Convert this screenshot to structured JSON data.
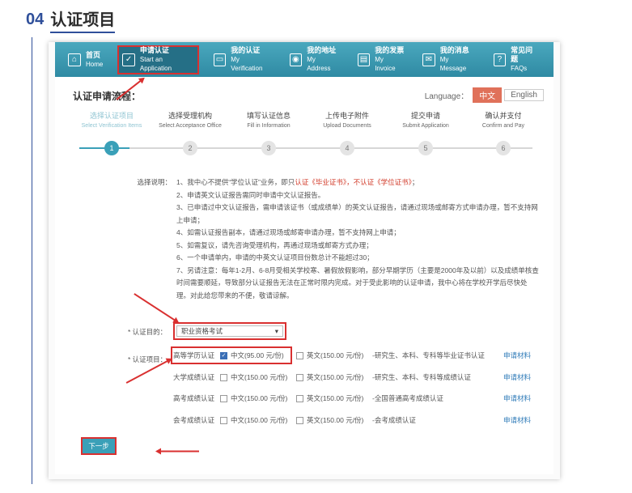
{
  "section": {
    "number": "04",
    "title": "认证项目"
  },
  "nav": [
    {
      "cn": "首页",
      "en": "Home",
      "icon": "home-icon",
      "glyph": "⌂"
    },
    {
      "cn": "申请认证",
      "en": "Start an Application",
      "icon": "check-icon",
      "glyph": "✓"
    },
    {
      "cn": "我的认证",
      "en": "My Verification",
      "icon": "card-icon",
      "glyph": "▭"
    },
    {
      "cn": "我的地址",
      "en": "My Address",
      "icon": "location-icon",
      "glyph": "◉"
    },
    {
      "cn": "我的发票",
      "en": "My Invoice",
      "icon": "invoice-icon",
      "glyph": "▤"
    },
    {
      "cn": "我的消息",
      "en": "My Message",
      "icon": "message-icon",
      "glyph": "✉"
    },
    {
      "cn": "常见问题",
      "en": "FAQs",
      "icon": "faq-icon",
      "glyph": "?"
    }
  ],
  "process_title": "认证申请流程：",
  "language": {
    "label": "Language：",
    "cn": "中文",
    "en": "English"
  },
  "steps": [
    {
      "cn": "选择认证项目",
      "en": "Select Verification Items",
      "num": "1"
    },
    {
      "cn": "选择受理机构",
      "en": "Select Acceptance Office",
      "num": "2"
    },
    {
      "cn": "填写认证信息",
      "en": "Fill in Information",
      "num": "3"
    },
    {
      "cn": "上传电子附件",
      "en": "Upload Documents",
      "num": "4"
    },
    {
      "cn": "提交申请",
      "en": "Submit Application",
      "num": "5"
    },
    {
      "cn": "确认并支付",
      "en": "Confirm and Pay",
      "num": "6"
    }
  ],
  "notes": {
    "label": "选择说明：",
    "n1_pre": "1、我中心不提供“学位认证”业务，即只",
    "n1_red": "认证《毕业证书》，不认证《学位证书》",
    "n1_post": "；",
    "n2": "2、申请英文认证报告需同时申请中文认证报告。",
    "n3": "3、已申请过中文认证报告，需申请该证书（或成绩单）的英文认证报告，请通过现场或邮寄方式申请办理，暂不支持网上申请；",
    "n4": "4、如需认证报告副本，请通过现场或邮寄申请办理，暂不支持网上申请；",
    "n5": "5、如需复议，请先咨询受理机构，再通过现场或邮寄方式办理；",
    "n6": "6、一个申请单内，申请的中英文认证项目份数总计不能超过30；",
    "n7": "7、另请注意：每年1-2月、6-8月受相关学校寒、暑假放假影响，部分早期学历（主要是2000年及以前）以及成绩单核查时间需要顺延，导致部分认证报告无法在正常时限内完成。对于受此影响的认证申请，我中心将在学校开学后尽快处理。对此给您带来的不便，敬请谅解。"
  },
  "purpose": {
    "label": "* 认证目的：",
    "value": "职业资格考试"
  },
  "items_label": "* 认证项目：",
  "items": [
    {
      "name": "高等学历认证",
      "cn": "中文(95.00 元/份)",
      "en": "英文(150.00 元/份)",
      "desc": "-研究生、本科、专科等毕业证书认证",
      "link": "申请材料",
      "checked": true
    },
    {
      "name": "大学成绩认证",
      "cn": "中文(150.00 元/份)",
      "en": "英文(150.00 元/份)",
      "desc": "-研究生、本科、专科等成绩认证",
      "link": "申请材料",
      "checked": false
    },
    {
      "name": "高考成绩认证",
      "cn": "中文(150.00 元/份)",
      "en": "英文(150.00 元/份)",
      "desc": "-全国普通高考成绩认证",
      "link": "申请材料",
      "checked": false
    },
    {
      "name": "会考成绩认证",
      "cn": "中文(150.00 元/份)",
      "en": "英文(150.00 元/份)",
      "desc": "-会考成绩认证",
      "link": "申请材料",
      "checked": false
    }
  ],
  "next_button": "下一步"
}
